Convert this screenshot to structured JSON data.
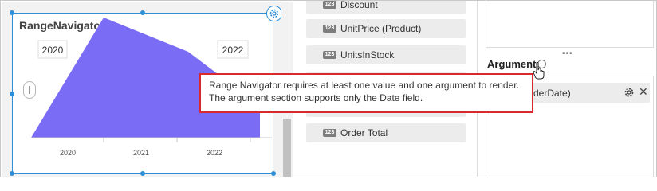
{
  "widget": {
    "title": "RangeNavigator1",
    "range_start_label": "2020",
    "range_end_label": "2022"
  },
  "chart_data": {
    "type": "area",
    "x": [
      "2020",
      "2021",
      "2022"
    ],
    "tick_labels": [
      "2020",
      "2021",
      "2022"
    ],
    "fill_color": "#7b6cf5"
  },
  "fields": [
    {
      "icon_text": "123",
      "label": "Discount"
    },
    {
      "icon_text": "123",
      "label": "UnitPrice (Product)"
    },
    {
      "icon_text": "123",
      "label": "UnitsInStock"
    },
    {
      "icon_text": "123",
      "label": "Order Total"
    }
  ],
  "right_panel": {
    "more_label": "•••",
    "argument_heading": "Argument",
    "argument_item": "rderDate)"
  },
  "tooltip": {
    "line1": "Range Navigator requires at least one value and one argument to render.",
    "line2": "The argument section supports only the Date field."
  },
  "colors": {
    "selection": "#2f8fd6",
    "tooltip_border": "#d9292f",
    "area_fill": "#7b6cf5"
  }
}
